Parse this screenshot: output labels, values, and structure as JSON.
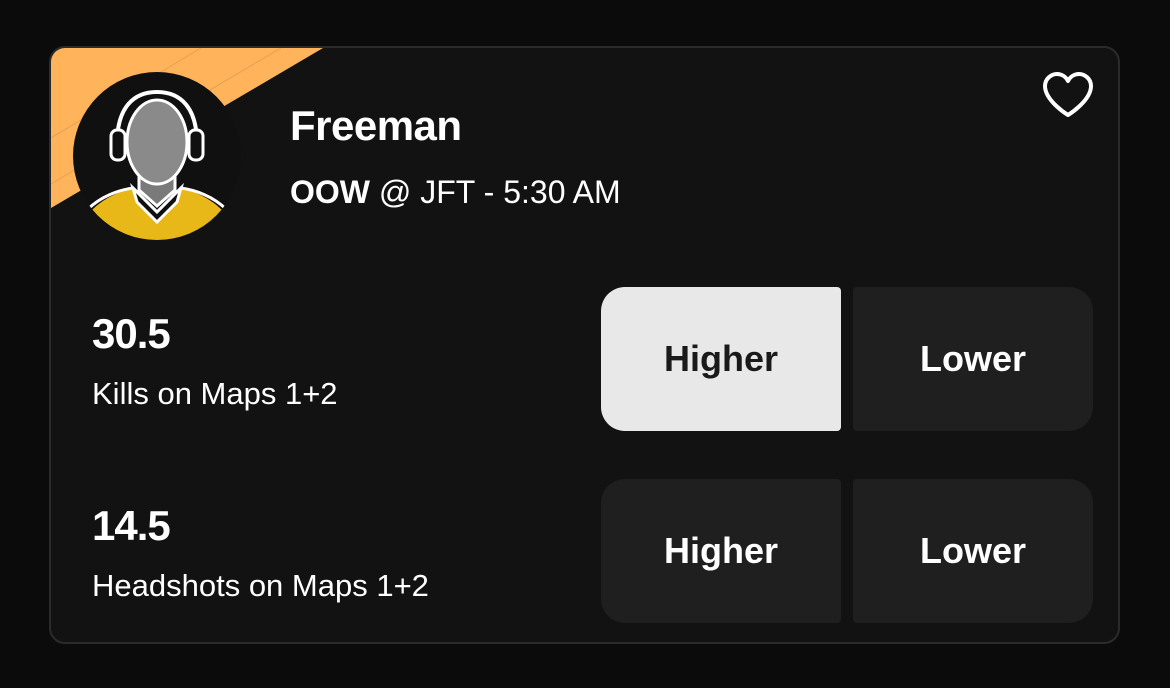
{
  "player": {
    "name": "Freeman",
    "team": "OOW",
    "matchup_rest": " @ JFT - 5:30 AM"
  },
  "colors": {
    "accent_stripe": "#ffb45c",
    "avatar_shirt": "#e8b818",
    "selected_button": "#e8e8e8",
    "button": "#1f1f1f"
  },
  "icons": {
    "favorite": "heart-outline-icon",
    "avatar": "player-silhouette-icon"
  },
  "props": [
    {
      "value": "30.5",
      "label": "Kills on Maps 1+2",
      "higher_label": "Higher",
      "lower_label": "Lower",
      "selected": "higher"
    },
    {
      "value": "14.5",
      "label": "Headshots on Maps 1+2",
      "higher_label": "Higher",
      "lower_label": "Lower",
      "selected": "none"
    }
  ]
}
